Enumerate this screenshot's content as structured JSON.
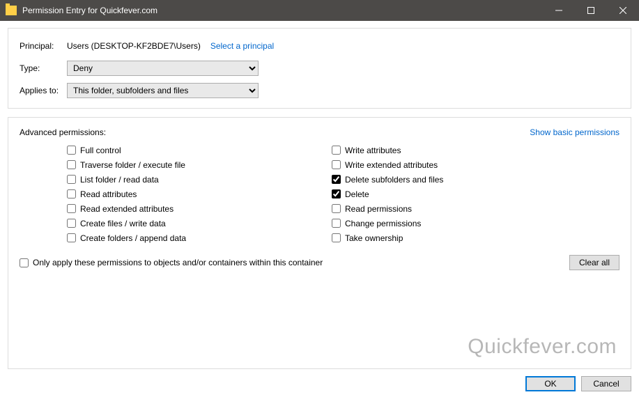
{
  "title": "Permission Entry for Quickfever.com",
  "header": {
    "principal_label": "Principal:",
    "principal_value": "Users (DESKTOP-KF2BDE7\\Users)",
    "select_principal_link": "Select a principal",
    "type_label": "Type:",
    "type_value": "Deny",
    "applies_label": "Applies to:",
    "applies_value": "This folder, subfolders and files"
  },
  "permissions": {
    "section_label": "Advanced permissions:",
    "show_basic_link": "Show basic permissions",
    "left": [
      {
        "label": "Full control",
        "checked": false
      },
      {
        "label": "Traverse folder / execute file",
        "checked": false
      },
      {
        "label": "List folder / read data",
        "checked": false
      },
      {
        "label": "Read attributes",
        "checked": false
      },
      {
        "label": "Read extended attributes",
        "checked": false
      },
      {
        "label": "Create files / write data",
        "checked": false
      },
      {
        "label": "Create folders / append data",
        "checked": false
      }
    ],
    "right": [
      {
        "label": "Write attributes",
        "checked": false
      },
      {
        "label": "Write extended attributes",
        "checked": false
      },
      {
        "label": "Delete subfolders and files",
        "checked": true
      },
      {
        "label": "Delete",
        "checked": true
      },
      {
        "label": "Read permissions",
        "checked": false
      },
      {
        "label": "Change permissions",
        "checked": false
      },
      {
        "label": "Take ownership",
        "checked": false
      }
    ],
    "only_apply_label": "Only apply these permissions to objects and/or containers within this container",
    "only_apply_checked": false,
    "clear_all_label": "Clear all"
  },
  "footer": {
    "ok_label": "OK",
    "cancel_label": "Cancel"
  },
  "watermark": "Quickfever.com"
}
